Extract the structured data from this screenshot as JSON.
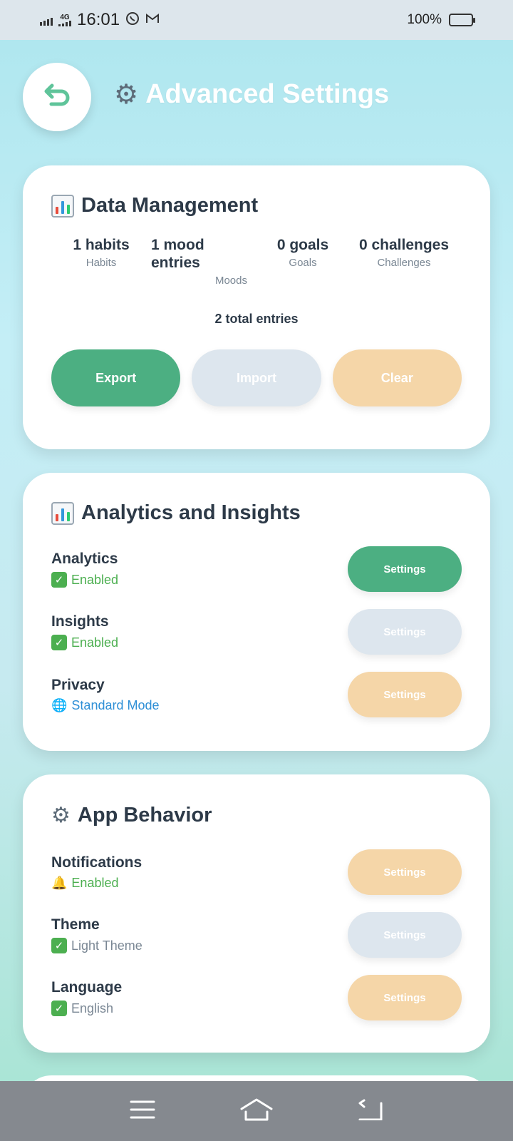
{
  "status_bar": {
    "time": "16:01",
    "network": "4G",
    "battery": "100%",
    "icons": [
      "signal-icon",
      "whatsapp-icon",
      "gmail-icon",
      "battery-icon"
    ]
  },
  "header": {
    "title": "Advanced Settings",
    "back_icon": "back-arrow-icon"
  },
  "data_management": {
    "title": "Data Management",
    "stats": [
      {
        "value": "1 habits",
        "label": "Habits"
      },
      {
        "value": "1 mood entries",
        "label": "Moods"
      },
      {
        "value": "0 goals",
        "label": "Goals"
      },
      {
        "value": "0 challenges",
        "label": "Challenges"
      }
    ],
    "total": "2 total entries",
    "buttons": {
      "export": "Export",
      "import": "Import",
      "clear": "Clear"
    }
  },
  "analytics": {
    "title": "Analytics and Insights",
    "rows": [
      {
        "name": "Analytics",
        "status": "Enabled",
        "button": "Settings"
      },
      {
        "name": "Insights",
        "status": "Enabled",
        "button": "Settings"
      },
      {
        "name": "Privacy",
        "status": "Standard Mode",
        "button": "Settings"
      }
    ]
  },
  "app_behavior": {
    "title": "App Behavior",
    "rows": [
      {
        "name": "Notifications",
        "status": "Enabled",
        "button": "Settings"
      },
      {
        "name": "Theme",
        "status": "Light Theme",
        "button": "Settings"
      },
      {
        "name": "Language",
        "status": "English",
        "button": "Settings"
      }
    ]
  },
  "colors": {
    "green": "#4caf82",
    "grey": "#dde6ee",
    "peach": "#f5d6a8",
    "text_dark": "#2d3a48",
    "status_green": "#4caf50",
    "status_blue": "#2e8fd6",
    "status_grey": "#7a8794"
  }
}
